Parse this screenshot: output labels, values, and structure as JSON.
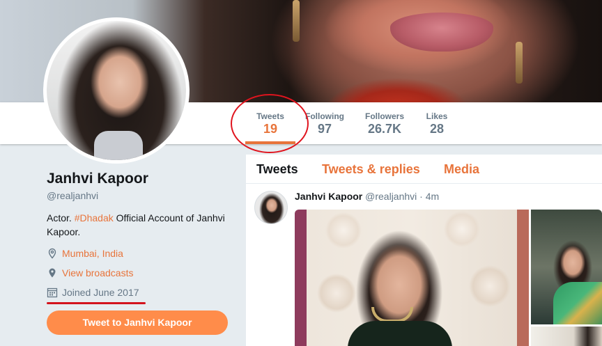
{
  "profile": {
    "name": "Janhvi Kapoor",
    "handle": "@realjanhvi",
    "bio_prefix": "Actor. ",
    "bio_hashtag": "#Dhadak",
    "bio_suffix": " Official Account of Janhvi Kapoor.",
    "location": "Mumbai, India",
    "broadcasts": "View broadcasts",
    "joined": "Joined June 2017",
    "tweet_to_button": "Tweet to Janhvi Kapoor"
  },
  "stats": [
    {
      "label": "Tweets",
      "value": "19",
      "active": true
    },
    {
      "label": "Following",
      "value": "97",
      "active": false
    },
    {
      "label": "Followers",
      "value": "26.7K",
      "active": false
    },
    {
      "label": "Likes",
      "value": "28",
      "active": false
    }
  ],
  "tabs": [
    {
      "label": "Tweets",
      "active": true
    },
    {
      "label": "Tweets & replies",
      "active": false
    },
    {
      "label": "Media",
      "active": false
    }
  ],
  "tweet": {
    "author": "Janhvi Kapoor",
    "handle_time": "@realjanhvi · 4m"
  },
  "icons": {
    "location": "location-pin-icon",
    "broadcasts": "broadcast-pin-icon",
    "joined": "calendar-icon"
  },
  "colors": {
    "accent": "#e8743b",
    "button": "#ff8c4a",
    "secondary_text": "#657786",
    "annotation_red": "#e0141e"
  }
}
